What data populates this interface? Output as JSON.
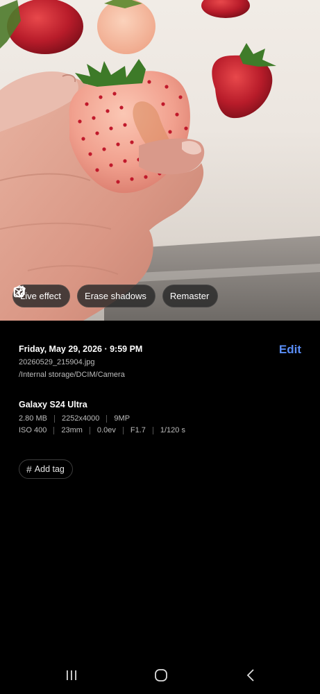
{
  "photo_actions": [
    {
      "label": "Live effect",
      "icon": "live-effect-icon"
    },
    {
      "label": "Erase shadows",
      "icon": "erase-shadows-icon"
    },
    {
      "label": "Remaster",
      "icon": "remaster-icon"
    }
  ],
  "details": {
    "datetime": "Friday, May 29, 2026 · 9:59 PM",
    "edit_label": "Edit",
    "filename": "20260529_215904.jpg",
    "path": "/Internal storage/DCIM/Camera",
    "device": "Galaxy S24 Ultra",
    "specs_row1": [
      "2.80 MB",
      "2252x4000",
      "9MP"
    ],
    "specs_row2": [
      "ISO 400",
      "23mm",
      "0.0ev",
      "F1.7",
      "1/120 s"
    ],
    "add_tag_label": "Add tag"
  },
  "colors": {
    "accent": "#5a8ef7",
    "background": "#000000",
    "chip_background": "#282828"
  },
  "nav": {
    "icons": [
      "recent-apps-icon",
      "home-icon",
      "back-icon"
    ]
  }
}
